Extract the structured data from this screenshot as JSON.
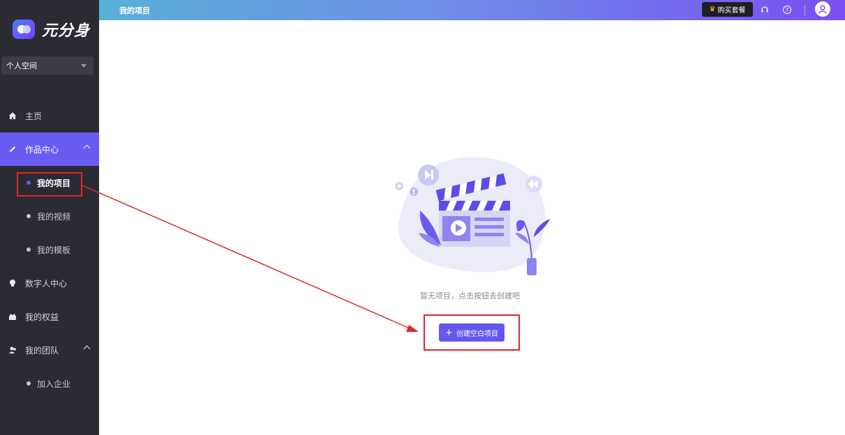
{
  "brand": {
    "name": "元分身"
  },
  "space_selector": {
    "value": "个人空间"
  },
  "sidebar": {
    "items": [
      {
        "label": "主页",
        "icon": "home-icon"
      },
      {
        "label": "作品中心",
        "icon": "pencil-icon",
        "expanded": true,
        "children": [
          {
            "label": "我的项目",
            "current": true
          },
          {
            "label": "我的视频"
          },
          {
            "label": "我的模板"
          }
        ]
      },
      {
        "label": "数字人中心",
        "icon": "digital-human-icon"
      },
      {
        "label": "我的权益",
        "icon": "benefits-icon"
      },
      {
        "label": "我的团队",
        "icon": "team-icon",
        "expanded": true,
        "children": [
          {
            "label": "加入企业"
          }
        ]
      }
    ]
  },
  "header": {
    "title": "我的项目",
    "buy_label": "购买套餐",
    "icons": [
      "headset-icon",
      "help-icon",
      "avatar-icon"
    ]
  },
  "main": {
    "empty_text": "暂无项目，点击按钮去创建吧",
    "create_label": "创建空白项目"
  },
  "colors": {
    "accent": "#6457ee",
    "sidebar_bg": "#2b2b33",
    "annotation_red": "#e0262b"
  }
}
